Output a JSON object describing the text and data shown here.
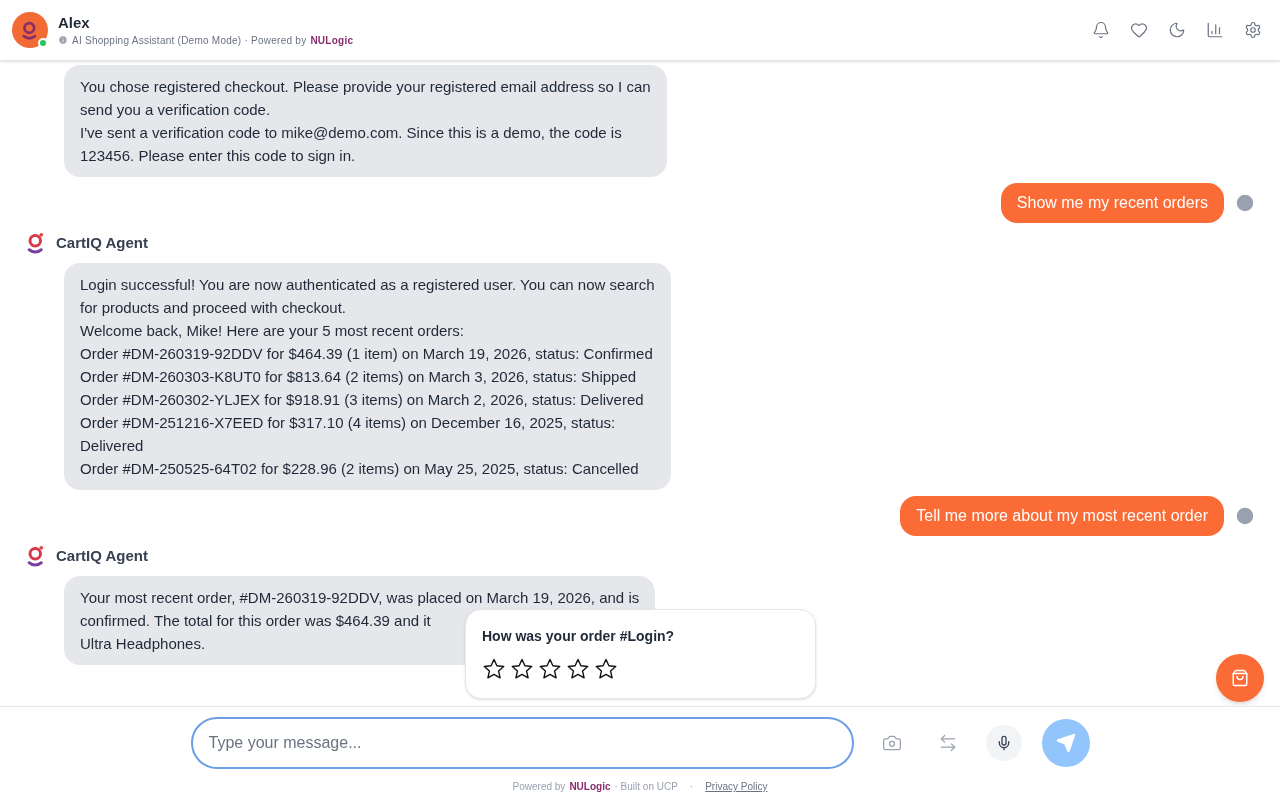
{
  "header": {
    "name": "Alex",
    "online": true,
    "subtitle": "AI Shopping Assistant (Demo Mode) · Powered by",
    "brand": "NULogic"
  },
  "messages": [
    {
      "kind": "agent",
      "lines": [
        "You chose registered checkout. Please provide your registered email address so I can",
        "send you a verification code.",
        "I've sent a verification code to mike@demo.com. Since this is a demo, the code is",
        "123456. Please enter this code to sign in."
      ]
    },
    {
      "kind": "user",
      "lines": [
        "Show me my recent orders"
      ]
    },
    {
      "kind": "agent",
      "sender": "CartIQ Agent",
      "lines": [
        "Login successful! You are now authenticated as a registered user. You can now search",
        "for products and proceed with checkout.",
        "Welcome back, Mike! Here are your 5 most recent orders:",
        "Order #DM-260319-92DDV for $464.39 (1 item) on March 19, 2026, status: Confirmed",
        "Order #DM-260303-K8UT0 for $813.64 (2 items) on March 3, 2026, status: Shipped",
        "Order #DM-260302-YLJEX for $918.91 (3 items) on March 2, 2026, status: Delivered",
        "Order #DM-251216-X7EED for $317.10 (4 items) on December 16, 2025, status:",
        "Delivered",
        "Order #DM-250525-64T02 for $228.96 (2 items) on May 25, 2025, status: Cancelled"
      ]
    },
    {
      "kind": "user",
      "lines": [
        "Tell me more about my most recent order"
      ]
    },
    {
      "kind": "agent",
      "sender": "CartIQ Agent",
      "lines": [
        "Your most recent order, #DM-260319-92DDV, was placed on March 19, 2026, and is",
        "confirmed. The total for this order was $464.39 and it",
        "Ultra Headphones."
      ]
    }
  ],
  "rating": {
    "question": "How was your order #Login?",
    "stars": 0
  },
  "composer": {
    "placeholder": "Type your message..."
  },
  "footer": {
    "prefix": "Powered by",
    "brand": "NULogic",
    "suffix": "· Built on UCP",
    "separator": "·",
    "link": "Privacy Policy"
  }
}
